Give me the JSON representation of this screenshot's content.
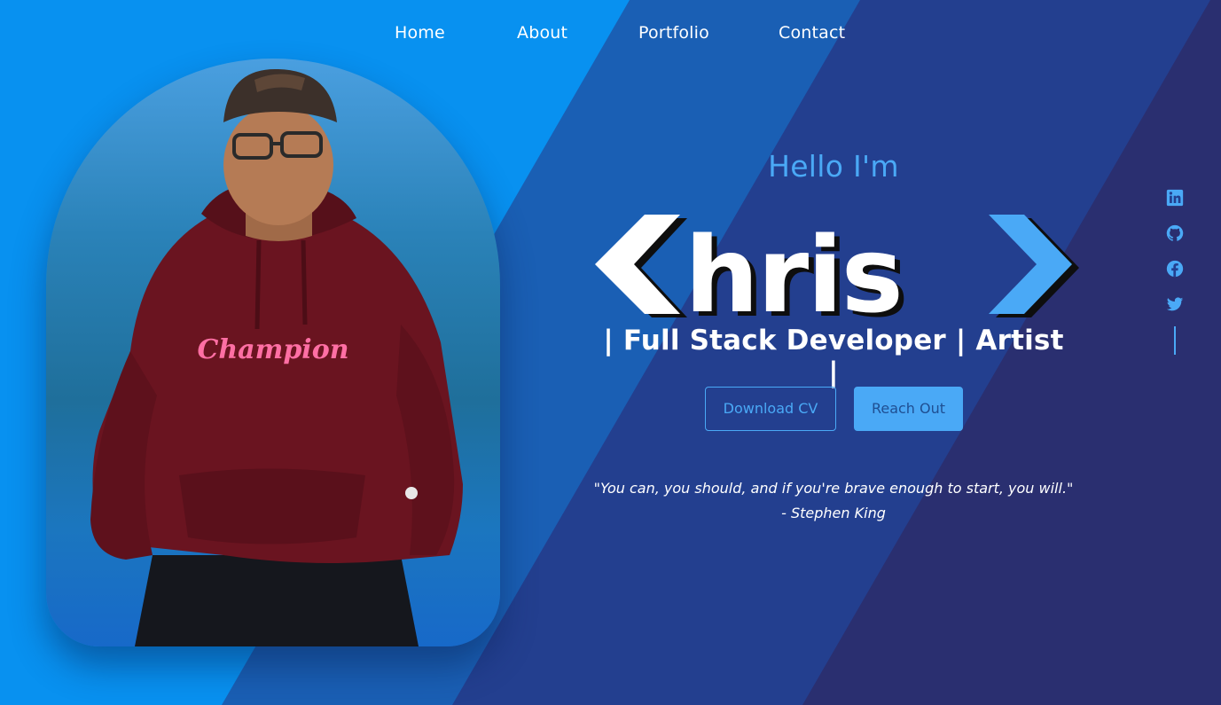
{
  "nav": {
    "items": [
      {
        "label": "Home"
      },
      {
        "label": "About"
      },
      {
        "label": "Portfolio"
      },
      {
        "label": "Contact"
      }
    ]
  },
  "hero": {
    "greeting": "Hello I'm",
    "logo_text": "hris",
    "tagline": "| Full Stack Developer | Artist |",
    "buttons": {
      "download_cv": "Download CV",
      "reach_out": "Reach Out"
    },
    "quote": {
      "text": "\"You can, you should, and if you're brave enough to start, you will.\"",
      "author": "- Stephen King"
    }
  },
  "photo": {
    "shirt_logo_text": "Champion"
  },
  "socials": [
    {
      "icon": "linkedin-icon"
    },
    {
      "icon": "github-icon"
    },
    {
      "icon": "facebook-icon"
    },
    {
      "icon": "twitter-icon"
    }
  ],
  "colors": {
    "bg_light_blue": "#0891f0",
    "bg_mid_blue": "#1a5fb4",
    "bg_navy": "#243e8c",
    "bg_dark_navy": "#2a2f6e",
    "accent": "#4aa9f6",
    "text": "#ffffff"
  }
}
